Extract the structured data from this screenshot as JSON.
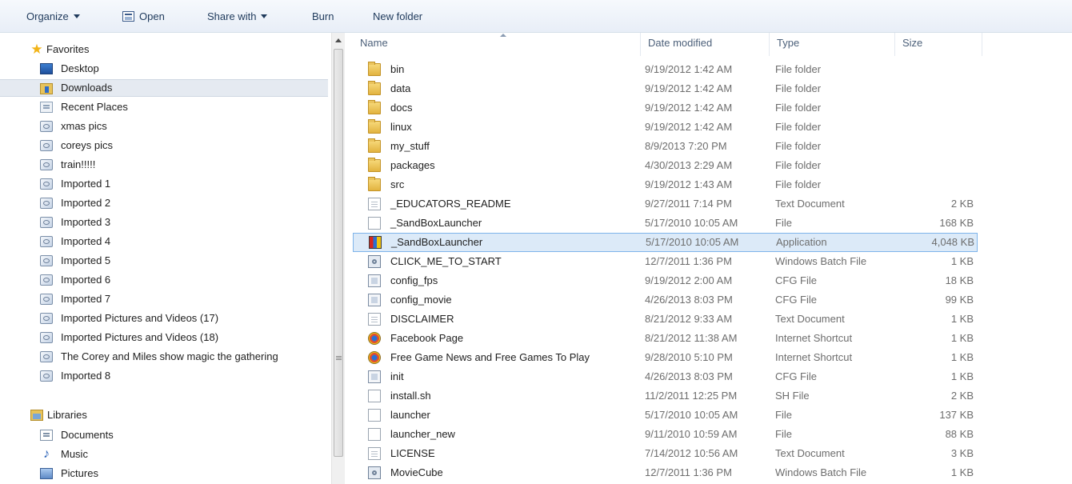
{
  "toolbar": {
    "organize": "Organize",
    "open": "Open",
    "share_with": "Share with",
    "burn": "Burn",
    "new_folder": "New folder"
  },
  "nav": {
    "favorites_label": "Favorites",
    "favorites": [
      {
        "label": "Desktop",
        "icon": "desktop-icon"
      },
      {
        "label": "Downloads",
        "icon": "downloads-icon",
        "selected": true
      },
      {
        "label": "Recent Places",
        "icon": "recent-places-icon"
      },
      {
        "label": "xmas pics",
        "icon": "library-folder-icon"
      },
      {
        "label": "coreys pics",
        "icon": "library-folder-icon"
      },
      {
        "label": "train!!!!!",
        "icon": "library-folder-icon"
      },
      {
        "label": "Imported 1",
        "icon": "library-folder-icon"
      },
      {
        "label": "Imported 2",
        "icon": "library-folder-icon"
      },
      {
        "label": "Imported 3",
        "icon": "library-folder-icon"
      },
      {
        "label": "Imported 4",
        "icon": "library-folder-icon"
      },
      {
        "label": "Imported 5",
        "icon": "library-folder-icon"
      },
      {
        "label": "Imported 6",
        "icon": "library-folder-icon"
      },
      {
        "label": "Imported 7",
        "icon": "library-folder-icon"
      },
      {
        "label": "Imported Pictures and Videos (17)",
        "icon": "library-folder-icon"
      },
      {
        "label": "Imported Pictures and Videos (18)",
        "icon": "library-folder-icon"
      },
      {
        "label": "The Corey and Miles show magic the gathering",
        "icon": "library-folder-icon"
      },
      {
        "label": "Imported 8",
        "icon": "library-folder-icon"
      }
    ],
    "libraries_label": "Libraries",
    "libraries": [
      {
        "label": "Documents",
        "icon": "documents-icon"
      },
      {
        "label": "Music",
        "icon": "music-icon"
      },
      {
        "label": "Pictures",
        "icon": "pictures-icon"
      }
    ]
  },
  "list": {
    "columns": {
      "name": "Name",
      "date": "Date modified",
      "type": "Type",
      "size": "Size"
    },
    "files": [
      {
        "name": "bin",
        "date": "9/19/2012 1:42 AM",
        "type": "File folder",
        "size": "",
        "icon": "folder-icon"
      },
      {
        "name": "data",
        "date": "9/19/2012 1:42 AM",
        "type": "File folder",
        "size": "",
        "icon": "folder-icon"
      },
      {
        "name": "docs",
        "date": "9/19/2012 1:42 AM",
        "type": "File folder",
        "size": "",
        "icon": "folder-icon"
      },
      {
        "name": "linux",
        "date": "9/19/2012 1:42 AM",
        "type": "File folder",
        "size": "",
        "icon": "folder-icon"
      },
      {
        "name": "my_stuff",
        "date": "8/9/2013 7:20 PM",
        "type": "File folder",
        "size": "",
        "icon": "folder-icon"
      },
      {
        "name": "packages",
        "date": "4/30/2013 2:29 AM",
        "type": "File folder",
        "size": "",
        "icon": "folder-icon"
      },
      {
        "name": "src",
        "date": "9/19/2012 1:43 AM",
        "type": "File folder",
        "size": "",
        "icon": "folder-icon"
      },
      {
        "name": "_EDUCATORS_README",
        "date": "9/27/2011 7:14 PM",
        "type": "Text Document",
        "size": "2 KB",
        "icon": "text-document-icon"
      },
      {
        "name": "_SandBoxLauncher",
        "date": "5/17/2010 10:05 AM",
        "type": "File",
        "size": "168 KB",
        "icon": "blank-file-icon"
      },
      {
        "name": "_SandBoxLauncher",
        "date": "5/17/2010 10:05 AM",
        "type": "Application",
        "size": "4,048 KB",
        "icon": "application-icon",
        "selected": true
      },
      {
        "name": "CLICK_ME_TO_START",
        "date": "12/7/2011 1:36 PM",
        "type": "Windows Batch File",
        "size": "1 KB",
        "icon": "batch-file-icon"
      },
      {
        "name": "config_fps",
        "date": "9/19/2012 2:00 AM",
        "type": "CFG File",
        "size": "18 KB",
        "icon": "cfg-file-icon"
      },
      {
        "name": "config_movie",
        "date": "4/26/2013 8:03 PM",
        "type": "CFG File",
        "size": "99 KB",
        "icon": "cfg-file-icon"
      },
      {
        "name": "DISCLAIMER",
        "date": "8/21/2012 9:33 AM",
        "type": "Text Document",
        "size": "1 KB",
        "icon": "text-document-icon"
      },
      {
        "name": "Facebook Page",
        "date": "8/21/2012 11:38 AM",
        "type": "Internet Shortcut",
        "size": "1 KB",
        "icon": "internet-shortcut-icon"
      },
      {
        "name": "Free Game News and Free Games To Play",
        "date": "9/28/2010 5:10 PM",
        "type": "Internet Shortcut",
        "size": "1 KB",
        "icon": "internet-shortcut-icon"
      },
      {
        "name": "init",
        "date": "4/26/2013 8:03 PM",
        "type": "CFG File",
        "size": "1 KB",
        "icon": "cfg-file-icon"
      },
      {
        "name": "install.sh",
        "date": "11/2/2011 12:25 PM",
        "type": "SH File",
        "size": "2 KB",
        "icon": "blank-file-icon"
      },
      {
        "name": "launcher",
        "date": "5/17/2010 10:05 AM",
        "type": "File",
        "size": "137 KB",
        "icon": "blank-file-icon"
      },
      {
        "name": "launcher_new",
        "date": "9/11/2010 10:59 AM",
        "type": "File",
        "size": "88 KB",
        "icon": "blank-file-icon"
      },
      {
        "name": "LICENSE",
        "date": "7/14/2012 10:56 AM",
        "type": "Text Document",
        "size": "3 KB",
        "icon": "text-document-icon"
      },
      {
        "name": "MovieCube",
        "date": "12/7/2011 1:36 PM",
        "type": "Windows Batch File",
        "size": "1 KB",
        "icon": "batch-file-icon"
      }
    ]
  },
  "colors": {
    "selection": "#dceaf8",
    "selection_border": "#7eb4ea",
    "toolbar_text": "#1e395b"
  }
}
